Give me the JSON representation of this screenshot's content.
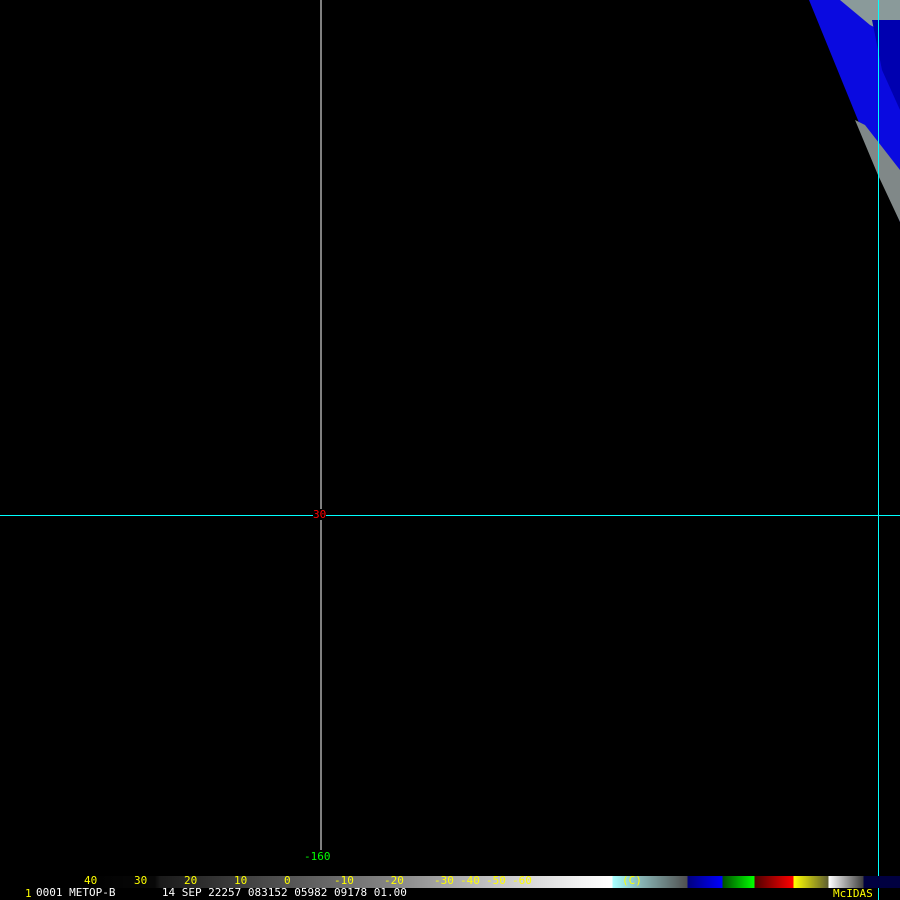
{
  "image": {
    "lat_label": "30",
    "lon_label": "-160",
    "colorbar_ticks": [
      "40",
      "30",
      "20",
      "10",
      "0",
      "-10",
      "-20",
      "-30",
      "-40",
      "-50",
      "-60"
    ],
    "colorbar_unit": "(C)",
    "frame_number": "1",
    "info_line": "0001 METOP-B       14 SEP 22257 083152 05982 09178 01.00",
    "brand": "McIDAS",
    "colors": {
      "grid_lat": "#00ffff",
      "grid_lon": "#ffffff",
      "lat_label": "#ff0000",
      "lon_label": "#00ff00",
      "text": "#ffff00"
    }
  }
}
